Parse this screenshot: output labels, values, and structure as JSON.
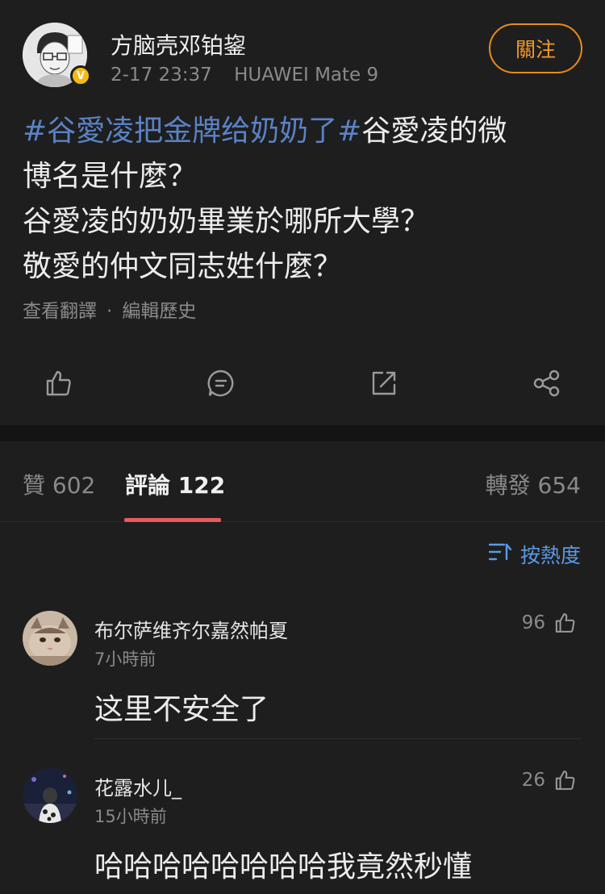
{
  "post": {
    "username": "方脑壳邓铂鋆",
    "date": "2-17 23:37",
    "device": "HUAWEI Mate 9",
    "verified_badge": "V",
    "follow_label": "關注",
    "content": {
      "tag1": "#谷愛凌把金牌给奶奶了#",
      "line1_rest": "谷愛凌的微",
      "line2": "博名是什麼？",
      "line3": "谷愛凌的奶奶畢業於哪所大學？",
      "line4": "敬愛的仲文同志姓什麼？"
    },
    "translate_label": "查看翻譯",
    "separator": "·",
    "edit_history_label": "編輯歷史",
    "actions": [
      "like-icon",
      "comment-icon",
      "repost-icon",
      "share-icon"
    ]
  },
  "tabs": {
    "likes": "贊 602",
    "comments": "評論 122",
    "reposts": "轉發 654"
  },
  "sort": {
    "label": "按熱度",
    "icon": "sort-icon"
  },
  "comments": [
    {
      "name": "布尔萨维齐尔嘉然帕夏",
      "time": "7小時前",
      "text": "这里不安全了",
      "likes": "96"
    },
    {
      "name": "花露水儿_",
      "time": "15小時前",
      "text": "哈哈哈哈哈哈哈哈我竟然秒懂",
      "likes": "26"
    }
  ],
  "colors": {
    "background": "#1e1e1f",
    "hashtag": "#5b82c4",
    "follow": "#f39a2b",
    "tab_indicator": "#e85a5e",
    "sort": "#5b9ae5"
  }
}
